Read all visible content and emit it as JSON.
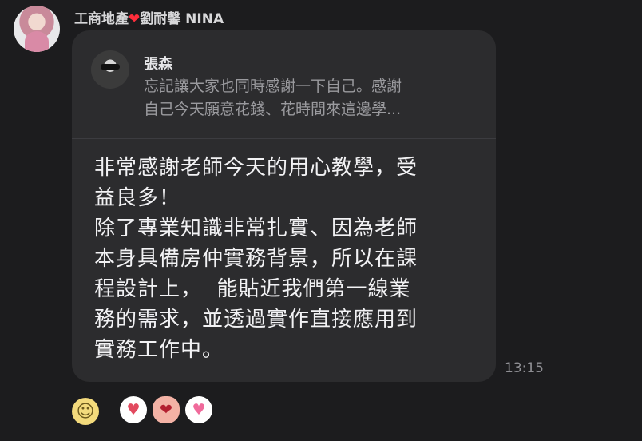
{
  "sender": {
    "name_prefix": "工商地產",
    "heart": "❤",
    "name_suffix": "劉耐馨 NINA"
  },
  "reply": {
    "author": "張森",
    "preview_line_1": "忘記讓大家也同時感謝一下自己。感謝",
    "preview_line_2": "自己今天願意花錢、花時間來這邊學..."
  },
  "message": {
    "text": "非常感謝老師今天的用心教學，受\n益良多！\n除了專業知識非常扎實、因為老師\n本身具備房仲實務背景，所以在課\n程設計上，  能貼近我們第一線業\n務的需求，並透過實作直接應用到\n實務工作中。",
    "time": "13:15"
  },
  "reactions": {
    "add_reaction_icon": "smiley-icon",
    "items": [
      {
        "name": "heart-eyes-icon",
        "glyph": "♥"
      },
      {
        "name": "character-icon",
        "glyph": "❤"
      },
      {
        "name": "pink-heart-face-icon",
        "glyph": "♥"
      }
    ]
  },
  "colors": {
    "background": "#1c1c1e",
    "bubble": "#2c2c2e",
    "heart": "#ff2d3b"
  }
}
